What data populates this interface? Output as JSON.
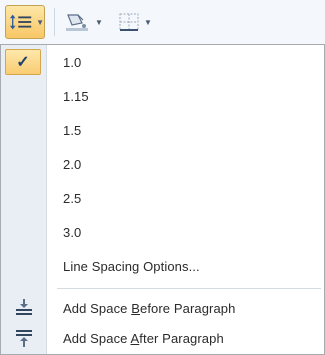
{
  "menu": {
    "selected_index": 0,
    "spacing_options": [
      "1.0",
      "1.15",
      "1.5",
      "2.0",
      "2.5",
      "3.0"
    ],
    "options_label": "Line Spacing Options...",
    "add_before": {
      "pre": "Add Space ",
      "accel": "B",
      "post": "efore Paragraph"
    },
    "add_after": {
      "pre": "Add Space ",
      "accel": "A",
      "post": "fter Paragraph"
    }
  },
  "icons": {
    "line_spacing": "line-spacing-icon",
    "shading": "shading-icon",
    "borders": "borders-icon",
    "check": "checkmark-icon",
    "space_before": "space-before-icon",
    "space_after": "space-after-icon"
  },
  "colors": {
    "highlight": "#f9cc72",
    "gutter": "#e9eef4",
    "text": "#2b2b2b"
  }
}
